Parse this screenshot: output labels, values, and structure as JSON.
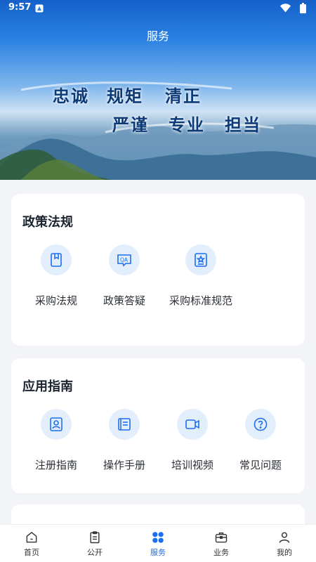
{
  "status_bar": {
    "time": "9:57"
  },
  "header": {
    "title": "服务"
  },
  "banner": {
    "line1": [
      "忠诚",
      "规矩",
      "清正"
    ],
    "line2": [
      "严谨",
      "专业",
      "担当"
    ]
  },
  "policy_section": {
    "title": "政策法规",
    "items": [
      {
        "label": "采购法规",
        "icon": "book-icon"
      },
      {
        "label": "政策答疑",
        "icon": "qa-icon"
      },
      {
        "label": "采购标准规范",
        "icon": "standard-icon"
      }
    ]
  },
  "guide_section": {
    "title": "应用指南",
    "items": [
      {
        "label": "注册指南",
        "icon": "user-card-icon"
      },
      {
        "label": "操作手册",
        "icon": "manual-icon"
      },
      {
        "label": "培训视频",
        "icon": "video-icon"
      },
      {
        "label": "常见问题",
        "icon": "question-icon"
      }
    ]
  },
  "tabbar": {
    "items": [
      {
        "label": "首页",
        "icon": "home-icon"
      },
      {
        "label": "公开",
        "icon": "clipboard-icon"
      },
      {
        "label": "服务",
        "icon": "grid-icon"
      },
      {
        "label": "业务",
        "icon": "briefcase-icon"
      },
      {
        "label": "我的",
        "icon": "person-icon"
      }
    ],
    "active": "服务"
  },
  "colors": {
    "accent": "#1d6ff2",
    "icon_bg": "#e3eefc",
    "page_bg": "#f2f4f7"
  }
}
